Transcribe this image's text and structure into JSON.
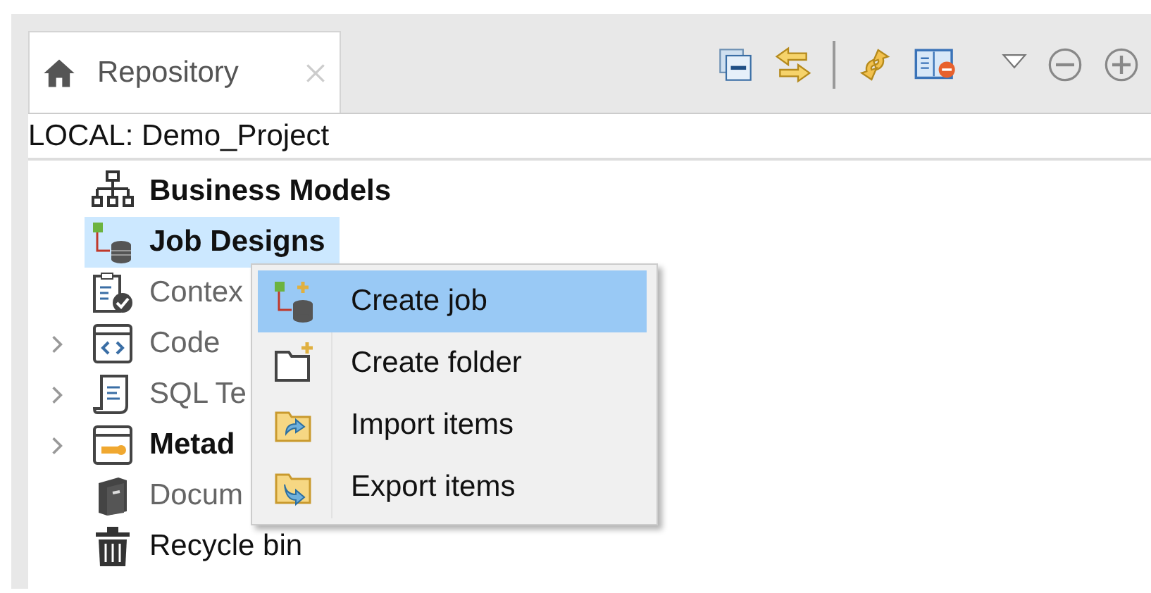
{
  "tab": {
    "label": "Repository",
    "selected": true
  },
  "project": "LOCAL: Demo_Project",
  "tree": [
    {
      "label": "Business Models",
      "bold": true,
      "disabled": false,
      "expandable": false,
      "selected": false
    },
    {
      "label": "Job Designs",
      "bold": true,
      "disabled": false,
      "expandable": false,
      "selected": true
    },
    {
      "label": "Contex",
      "bold": false,
      "disabled": true,
      "expandable": false,
      "selected": false
    },
    {
      "label": "Code",
      "bold": false,
      "disabled": true,
      "expandable": true,
      "selected": false
    },
    {
      "label": "SQL Te",
      "bold": false,
      "disabled": true,
      "expandable": true,
      "selected": false
    },
    {
      "label": "Metad",
      "bold": true,
      "disabled": false,
      "expandable": true,
      "selected": false
    },
    {
      "label": "Docum",
      "bold": false,
      "disabled": true,
      "expandable": false,
      "selected": false
    },
    {
      "label": "Recycle bin",
      "bold": false,
      "disabled": false,
      "expandable": false,
      "selected": false
    }
  ],
  "context_menu": [
    {
      "label": "Create job",
      "selected": true
    },
    {
      "label": "Create folder",
      "selected": false
    },
    {
      "label": "Import items",
      "selected": false
    },
    {
      "label": "Export items",
      "selected": false
    }
  ]
}
